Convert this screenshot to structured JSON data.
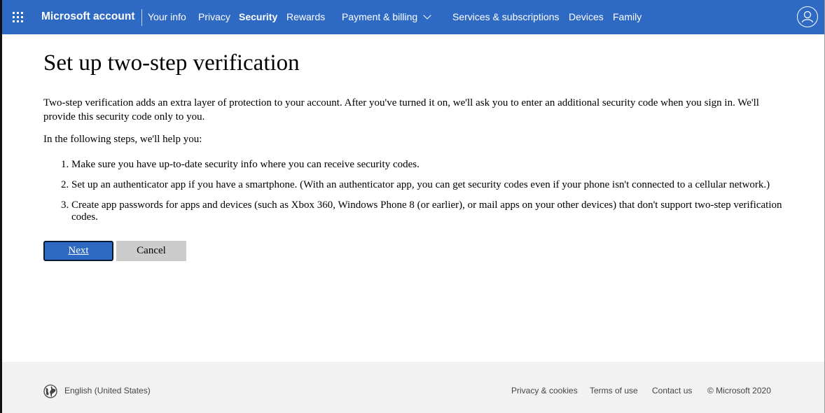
{
  "header": {
    "brand": "Microsoft account",
    "nav": [
      "Your info",
      "Privacy",
      "Security",
      "Rewards",
      "Payment & billing",
      "Services & subscriptions",
      "Devices",
      "Family"
    ],
    "active": "Security",
    "bg_color": "#2e6ac4"
  },
  "main": {
    "title": "Set up two-step verification",
    "intro": "Two-step verification adds an extra layer of protection to your account. After you've turned it on, we'll ask you to enter an additional security code when you sign in. We'll provide this security code only to you.",
    "lead": "In the following steps, we'll help you:",
    "steps": [
      "Make sure you have up-to-date security info where you can receive security codes.",
      "Set up an authenticator app if you have a smartphone. (With an authenticator app, you can get security codes even if your phone isn't connected to a cellular network.)",
      "Create app passwords for apps and devices (such as Xbox 360, Windows Phone 8 (or earlier), or mail apps on your other devices) that don't support two-step verification codes."
    ],
    "next_label": "Next",
    "cancel_label": "Cancel"
  },
  "footer": {
    "language": "English (United States)",
    "links": [
      "Privacy & cookies",
      "Terms of use",
      "Contact us"
    ],
    "copyright": "© Microsoft 2020"
  }
}
